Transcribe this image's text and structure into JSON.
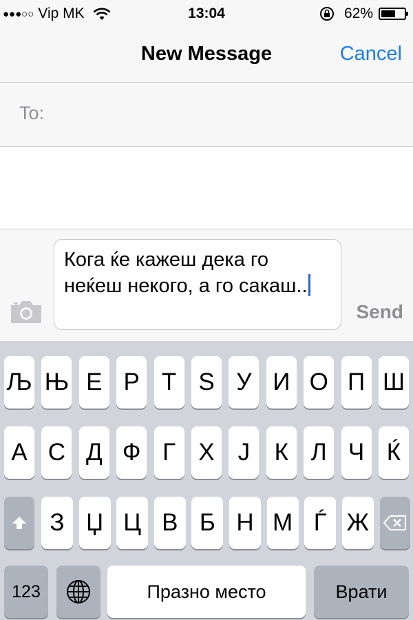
{
  "status_bar": {
    "signal": "●●●○○",
    "carrier": "Vip MK",
    "time": "13:04",
    "battery_percent": "62%",
    "battery_level": 0.62,
    "icons": [
      "wifi-icon",
      "rotation-lock-icon",
      "battery-icon"
    ]
  },
  "nav": {
    "title": "New Message",
    "cancel_label": "Cancel",
    "accent_color": "#1a7cf0"
  },
  "recipient": {
    "label": "To:",
    "value": ""
  },
  "compose": {
    "text": "Кога ќе кажеш дека го неќеш некого, а го сакаш..",
    "send_label": "Send",
    "camera_icon": "camera-icon"
  },
  "keyboard": {
    "row1": [
      "Љ",
      "Њ",
      "Е",
      "Р",
      "Т",
      "Ѕ",
      "У",
      "И",
      "О",
      "П",
      "Ш"
    ],
    "row2": [
      "А",
      "С",
      "Д",
      "Ф",
      "Г",
      "Х",
      "Ј",
      "К",
      "Л",
      "Ч",
      "Ќ"
    ],
    "row3": [
      "З",
      "Џ",
      "Ц",
      "В",
      "Б",
      "Н",
      "М",
      "Ѓ",
      "Ж"
    ],
    "numbers_label": "123",
    "space_label": "Празно место",
    "return_label": "Врати",
    "icons": [
      "shift-icon",
      "backspace-icon",
      "globe-icon"
    ]
  }
}
